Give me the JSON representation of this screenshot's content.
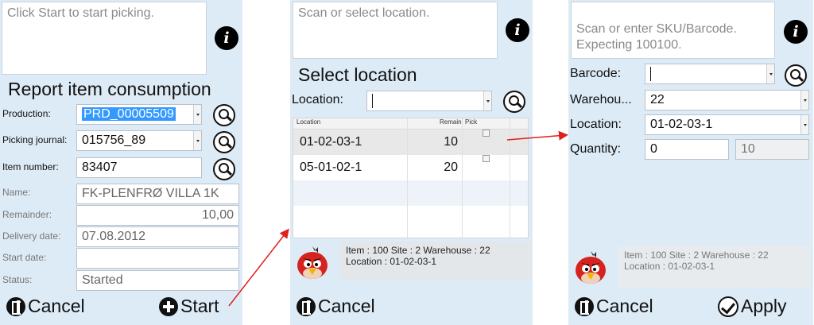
{
  "screen1": {
    "message": "Click Start to start picking.",
    "title": "Report item consumption",
    "fields": {
      "production_label": "Production:",
      "production_value": "PRD_00005509",
      "journal_label": "Picking journal:",
      "journal_value": "015756_89",
      "item_label": "Item number:",
      "item_value": "83407",
      "name_label": "Name:",
      "name_value": "FK-PLENFRØ VILLA 1K",
      "remainder_label": "Remainder:",
      "remainder_value": "10,00",
      "delivery_label": "Delivery date:",
      "delivery_value": "07.08.2012",
      "start_label": "Start date:",
      "start_value": "",
      "status_label": "Status:",
      "status_value": "Started"
    },
    "cancel_label": "Cancel",
    "start_label": "Start"
  },
  "screen2": {
    "message": "Scan or select location.",
    "title": "Select location",
    "location_label": "Location:",
    "location_value": "",
    "grid": {
      "headers": [
        "Location",
        "Remain",
        "Pick"
      ],
      "rows": [
        {
          "location": "01-02-03-1",
          "remain": "10"
        },
        {
          "location": "05-01-02-1",
          "remain": "20"
        }
      ]
    },
    "info": {
      "line1": "Item : 100  Site : 2  Warehouse : 22",
      "line2": "Location : 01-02-03-1"
    },
    "cancel_label": "Cancel"
  },
  "screen3": {
    "message": "Scan or enter SKU/Barcode.\nExpecting 100100.",
    "barcode_label": "Barcode:",
    "barcode_value": "",
    "warehouse_label": "Warehou...",
    "warehouse_value": "22",
    "location_label": "Location:",
    "location_value": "01-02-03-1",
    "quantity_label": "Quantity:",
    "quantity_value": "0",
    "quantity_expected": "10",
    "info": {
      "line1": "Item : 100  Site : 2  Warehouse : 22",
      "line2": "Location : 01-02-03-1"
    },
    "cancel_label": "Cancel",
    "apply_label": "Apply"
  },
  "colors": {
    "screen_bg": "#ddebf6",
    "selection": "#3399ff",
    "arrow": "#e0201c"
  }
}
